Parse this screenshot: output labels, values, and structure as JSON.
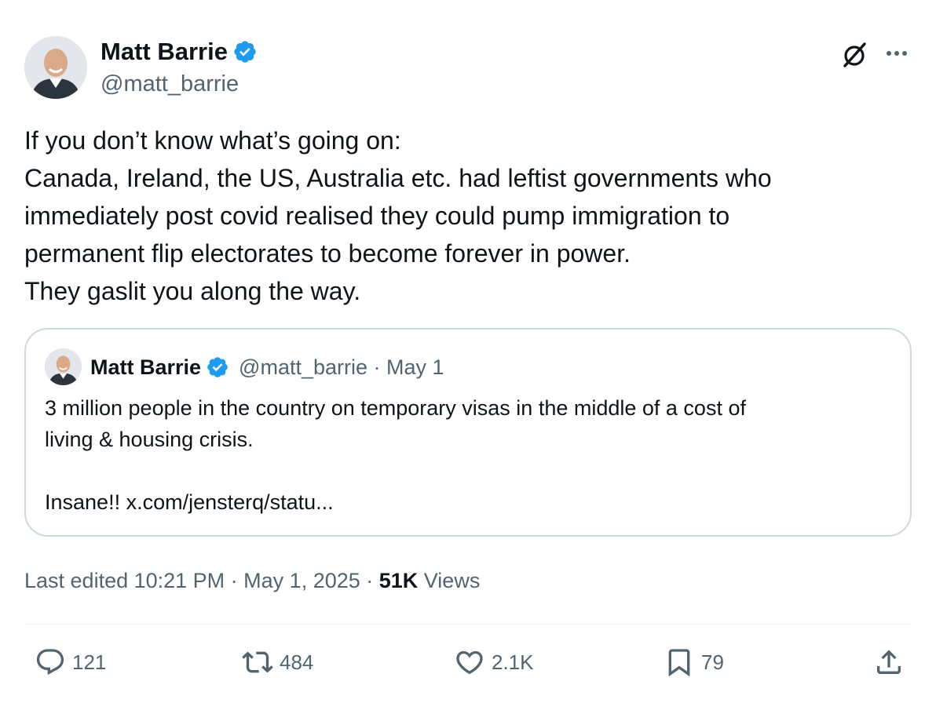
{
  "colors": {
    "primary_text": "#0f1419",
    "secondary_text": "#536471",
    "verified": "#1d9bf0",
    "border": "#cfd9de"
  },
  "author": {
    "name": "Matt Barrie",
    "handle": "@matt_barrie",
    "avatar_icon": "person-avatar",
    "verified_icon": "verified-badge-icon"
  },
  "header_actions": {
    "grok_icon": "grok-icon",
    "more_icon": "more-icon"
  },
  "tweet": {
    "lines": [
      "If you don’t know what’s going on:",
      "Canada, Ireland, the US, Australia etc. had leftist governments who",
      "immediately post covid realised they could pump immigration to",
      "permanent flip electorates to become forever in power.",
      "They gaslit you along the way."
    ]
  },
  "quoted_tweet": {
    "name": "Matt Barrie",
    "meta": "@matt_barrie · May 1",
    "lines": [
      "3 million people in the country on temporary visas in the middle of a cost of",
      "living & housing crisis.",
      "",
      "Insane!! x.com/jensterq/statu..."
    ]
  },
  "meta": {
    "prefix": "Last edited 10:21 PM · May 1, 2025 · ",
    "views_count": "51K",
    "views_label": " Views"
  },
  "actions": {
    "replies": "121",
    "reposts": "484",
    "likes": "2.1K",
    "bookmarks": "79"
  }
}
